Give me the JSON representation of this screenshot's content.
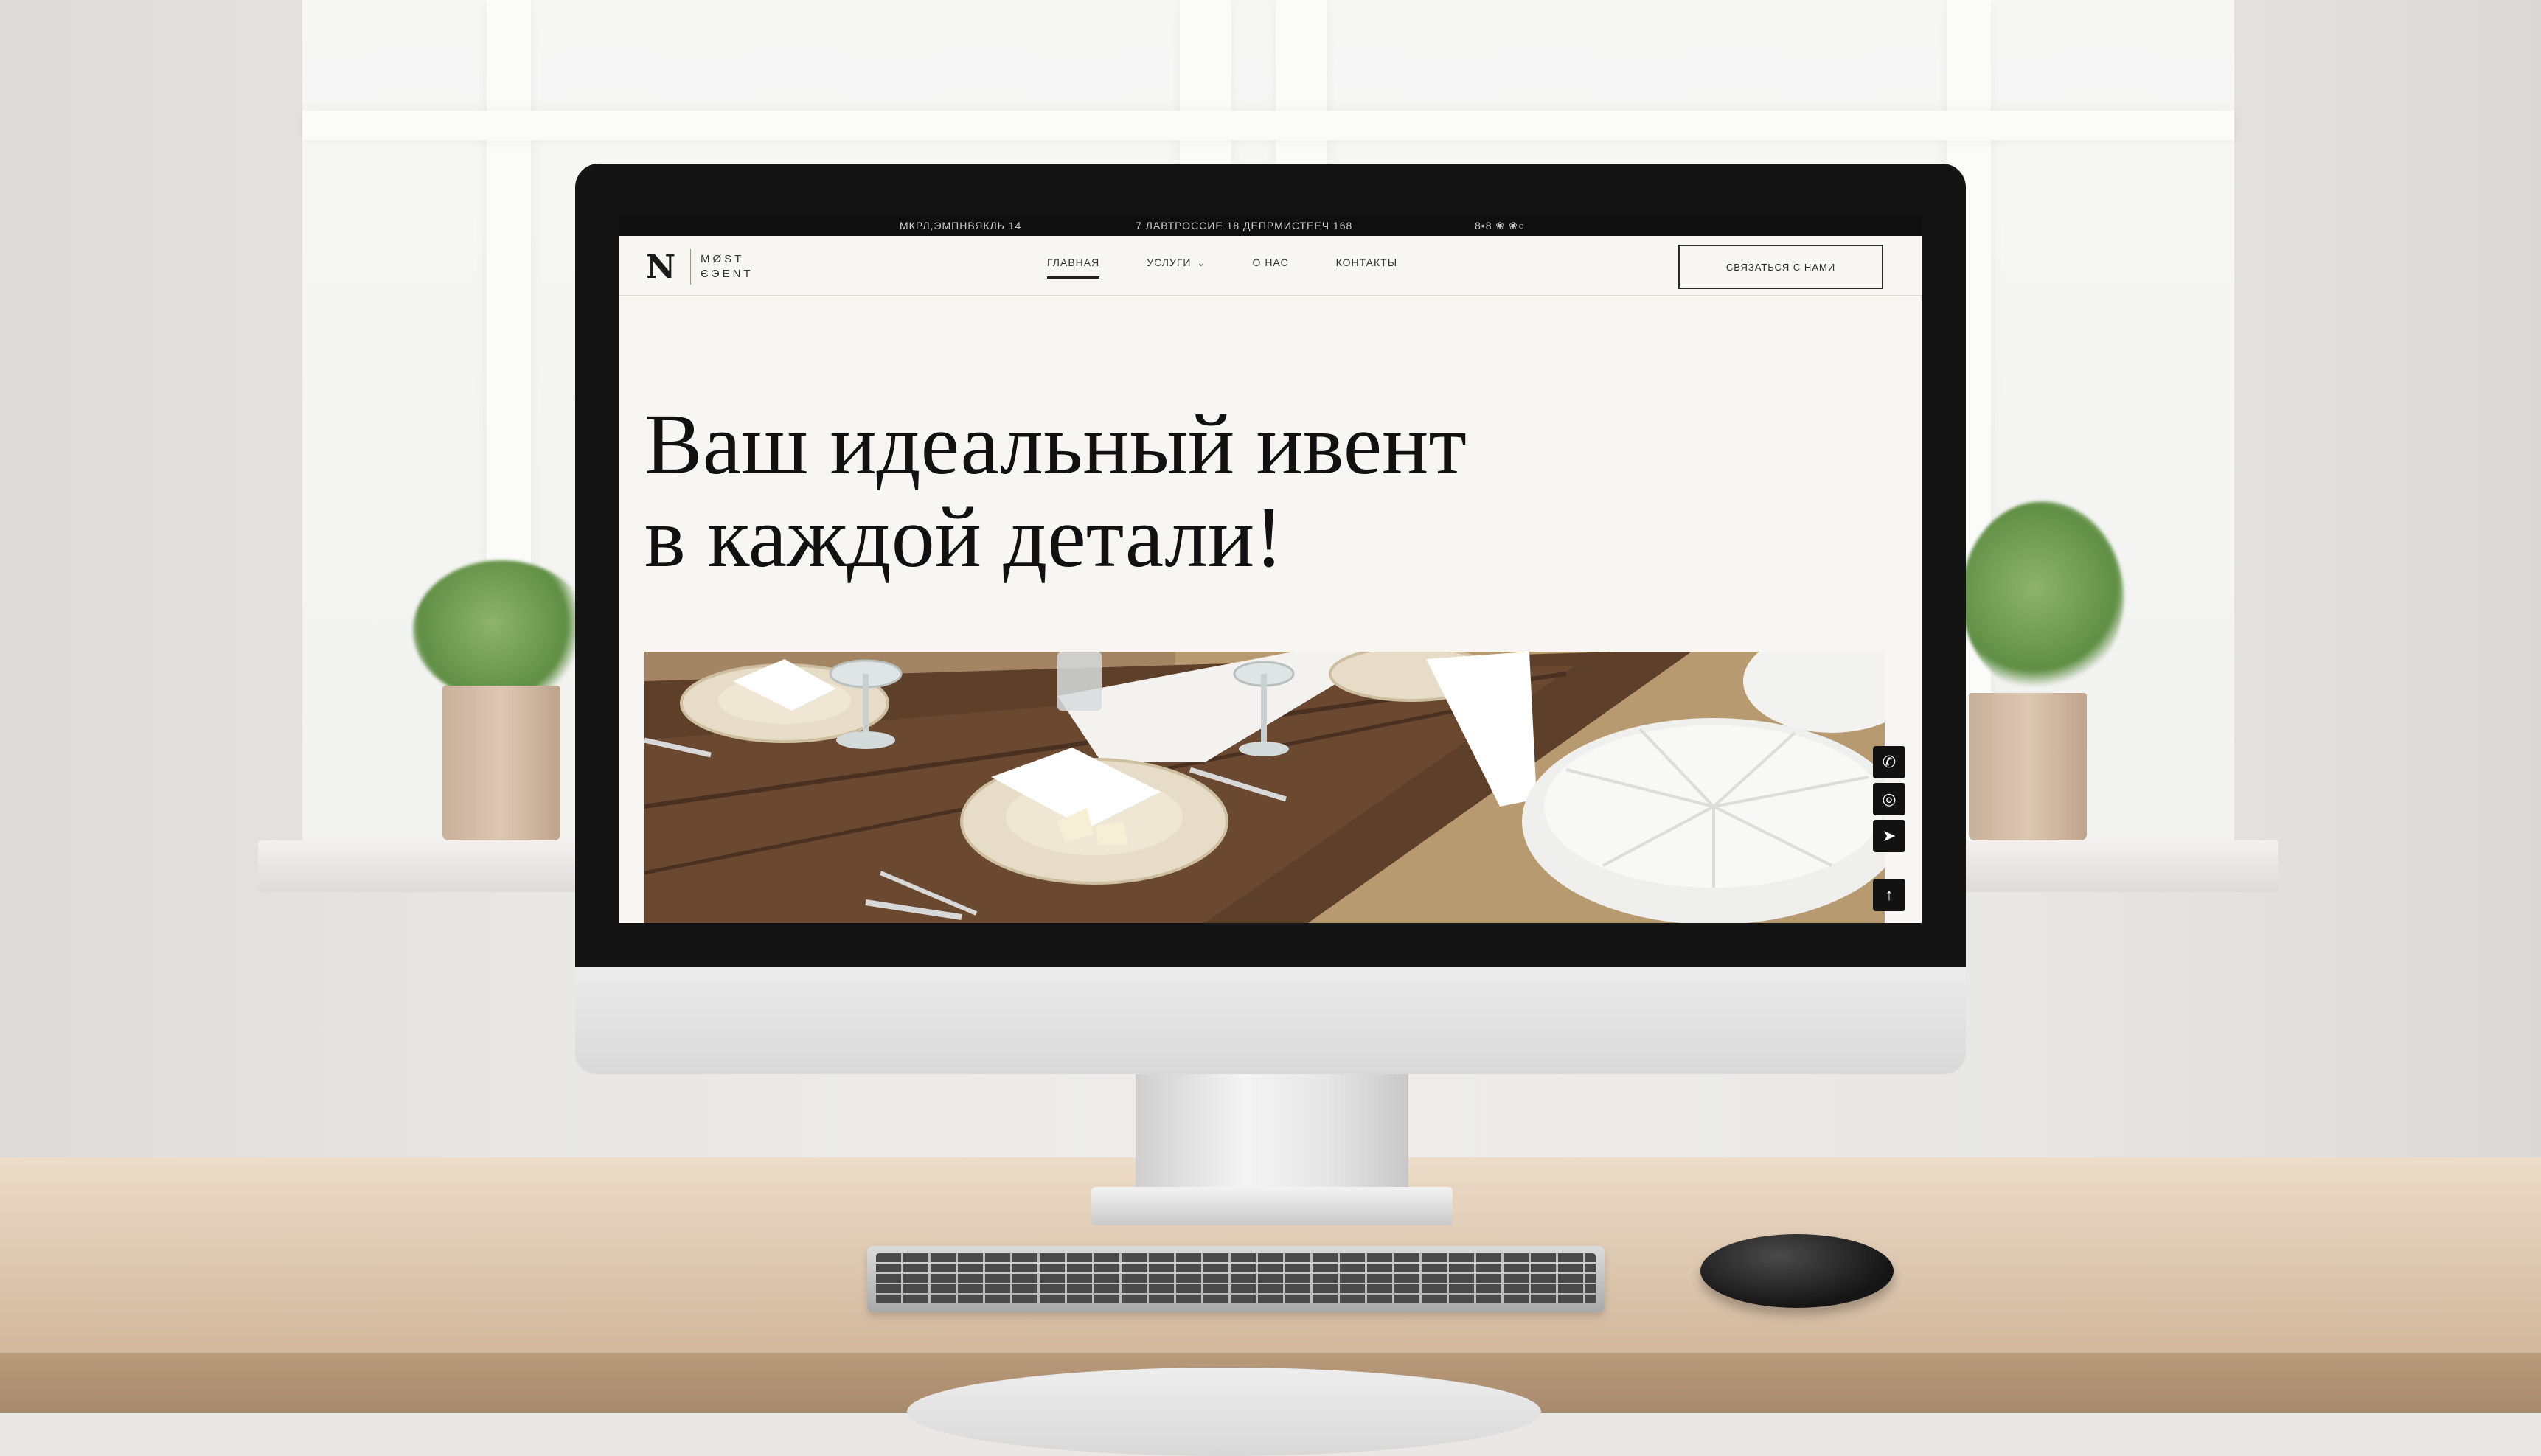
{
  "topbar": {
    "left": "МКРЛ,ЭМПНВЯКЛЬ 14",
    "center": "7 ЛАВТРОССИЕ 18 ДЕПРМИСТЕЕЧ 168",
    "right": "8•8 ❀ ❀○"
  },
  "logo": {
    "mark": "N",
    "line1": "MØST",
    "line2": "ЄЭENT"
  },
  "nav": {
    "items": [
      {
        "label": "ГЛАВНАЯ",
        "active": true
      },
      {
        "label": "УСЛУГИ",
        "dropdown": true
      },
      {
        "label": "О НАС"
      },
      {
        "label": "КОНТАКТЫ"
      }
    ]
  },
  "header_cta": "СВЯЗАТЬСЯ С НАМИ",
  "hero": {
    "line1": "Ваш идеальный ивент",
    "line2": "в каждой детали!"
  },
  "floating_buttons": [
    {
      "icon": "phone-icon",
      "glyph": "✆"
    },
    {
      "icon": "whatsapp-icon",
      "glyph": "◎"
    },
    {
      "icon": "telegram-icon",
      "glyph": "➤"
    },
    {
      "icon": "scroll-top-icon",
      "glyph": "↑"
    }
  ],
  "colors": {
    "page_background": "#f8f6f2",
    "text_primary": "#111111",
    "topbar": "#0f0f0f",
    "accent_dark": "#121212"
  }
}
